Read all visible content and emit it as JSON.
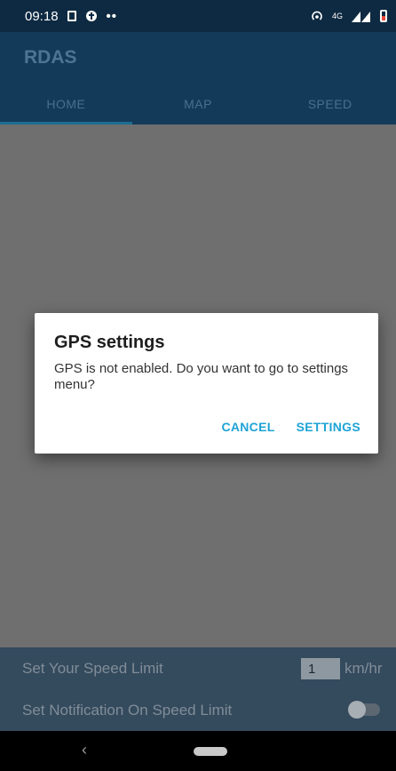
{
  "status_bar": {
    "time": "09:18",
    "dots": "••",
    "network_label": "4G",
    "icons": [
      "notification-box-icon",
      "app-notification-icon",
      "more-dots-icon",
      "hotspot-icon",
      "4g-data-icon",
      "signal-icon",
      "battery-icon"
    ],
    "battery_color": "#e64a3b"
  },
  "app_bar": {
    "title": "RDAS"
  },
  "tabs": [
    {
      "label": "HOME",
      "active": true
    },
    {
      "label": "MAP",
      "active": false
    },
    {
      "label": "SPEED",
      "active": false
    }
  ],
  "bottom_panel": {
    "speed_limit_label": "Set Your Speed Limit",
    "speed_limit_value": "1",
    "speed_unit": "km/hr",
    "notification_label": "Set Notification On Speed Limit",
    "notification_enabled": false
  },
  "dialog": {
    "title": "GPS  settings",
    "message": "GPS is not enabled. Do you want to go to settings menu?",
    "cancel_label": "CANCEL",
    "settings_label": "SETTINGS",
    "button_color": "#1ea3d7"
  },
  "nav_bar": {
    "back_glyph": "‹"
  }
}
